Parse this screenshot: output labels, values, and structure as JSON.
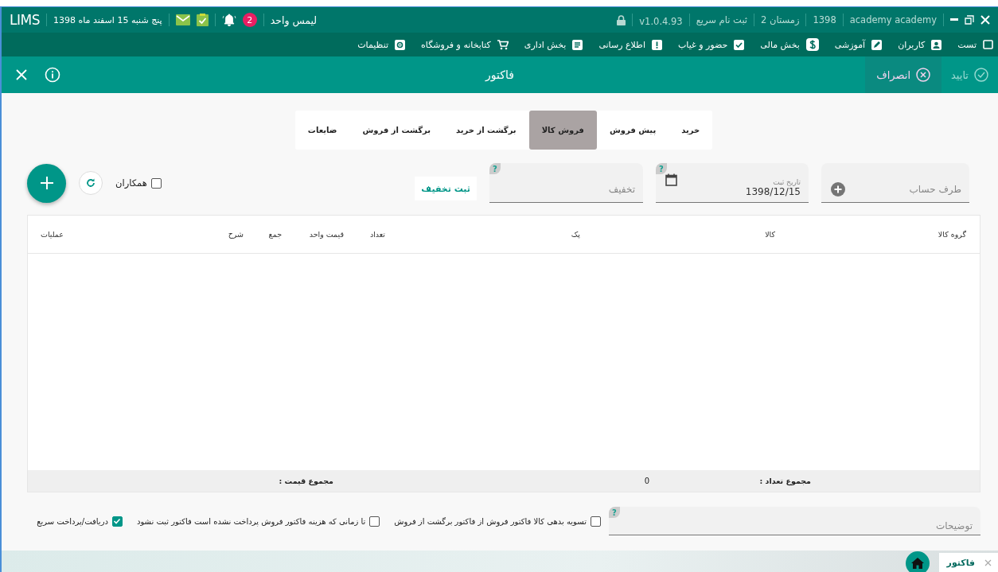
{
  "title_bar": {
    "app_name": "LIMS",
    "date": "پنج شنبه 15 اسفند ماه 1398",
    "notification_count": "2",
    "unit": "لیمس واحد",
    "user": "academy academy",
    "year": "1398",
    "term": "زمستان 2",
    "quick_register": "ثبت نام سریع",
    "version": "v1.0.4.93"
  },
  "menu": [
    {
      "label": "تست"
    },
    {
      "label": "کاربران"
    },
    {
      "label": "آموزشی"
    },
    {
      "label": "بخش مالی"
    },
    {
      "label": "حضور و غیاب"
    },
    {
      "label": "اطلاع رسانی"
    },
    {
      "label": "بخش اداری"
    },
    {
      "label": "کتابخانه و فروشگاه"
    },
    {
      "label": "تنظیمات"
    }
  ],
  "header": {
    "title": "فاکتور",
    "confirm": {
      "label": "تایید",
      "disabled": true
    },
    "cancel": {
      "label": "انصراف",
      "disabled": false
    }
  },
  "tabs": [
    {
      "label": "خرید",
      "selected": false
    },
    {
      "label": "پیش فروش",
      "selected": false
    },
    {
      "label": "فروش کالا",
      "selected": true
    },
    {
      "label": "برگشت از خرید",
      "selected": false
    },
    {
      "label": "برگشت از فروش",
      "selected": false
    },
    {
      "label": "ضایعات",
      "selected": false
    }
  ],
  "form": {
    "account": {
      "placeholder": "طرف حساب"
    },
    "date": {
      "label": "تاریخ ثبت",
      "value": "1398/12/15",
      "help": "?"
    },
    "discount": {
      "placeholder": "تخفیف",
      "help": "?"
    },
    "discount_button": "ثبت تخفیف",
    "colleagues": {
      "label": "همکاران",
      "checked": false
    }
  },
  "table": {
    "columns": [
      "گروه کالا",
      "کالا",
      "پک",
      "تعداد",
      "قیمت واحد",
      "جمع",
      "شرح",
      "عملیات"
    ],
    "footer": {
      "count_label": "مجموع تعداد :",
      "count_value": "0",
      "price_label": "مجموع قیمت :"
    }
  },
  "notes": {
    "placeholder": "توضیحات",
    "help": "?"
  },
  "options": [
    {
      "label": "تسویه بدهی کالا فاکتور فروش از فاکتور برگشت از فروش",
      "checked": false
    },
    {
      "label": "تا زمانی که هزینه فاکتور فروش پرداخت نشده است فاکتور ثبت نشود",
      "checked": false
    },
    {
      "label": "دریافت/پرداخت سریع",
      "checked": true
    }
  ],
  "taskbar": {
    "tabs": [
      {
        "label": "فاکتور",
        "selected": true
      }
    ]
  }
}
